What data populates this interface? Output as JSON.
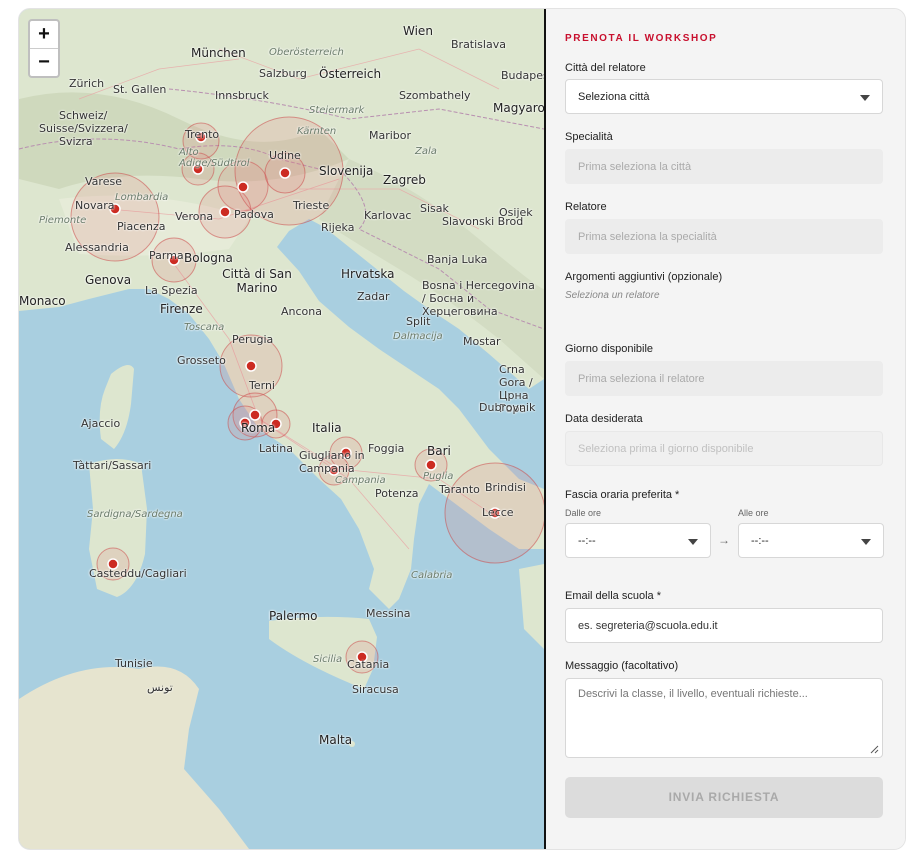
{
  "map": {
    "zoom_in_label": "+",
    "zoom_out_label": "−",
    "cities": [
      "Zürich",
      "München",
      "Salzburg",
      "Österreich",
      "Wien",
      "Bratislava",
      "Budapest",
      "St. Gallen",
      "Schweiz/",
      "Suisse/Svizzera/",
      "Svizra",
      "Innsbruck",
      "Kärnten",
      "Udine",
      "Slovenija",
      "Zagreb",
      "Maribor",
      "Szombathely",
      "Magyarország",
      "Varese",
      "Novara",
      "Lombardia",
      "Piemonte",
      "Verona",
      "Padova",
      "Trieste",
      "Rijeka",
      "Karlovac",
      "Sisak",
      "Slavonski Brod",
      "Osijek",
      "Alessandria",
      "Piacenza",
      "Parma",
      "Bologna",
      "Genova",
      "Città di San Marino",
      "Hrvatska",
      "Banja Luka",
      "Bosna i Hercegovina / Босна и Херцеговина",
      "Monaco",
      "La Spezia",
      "Firenze",
      "Toscana",
      "Ancona",
      "Zadar",
      "Split",
      "Mostar",
      "Perugia",
      "Grosseto",
      "Terni",
      "Crna Gora / Црна Гора",
      "Ajaccio",
      "Roma",
      "Latina",
      "Italia",
      "Bari",
      "Foggia",
      "Taranto",
      "Brindisi",
      "Lecce",
      "Puglia",
      "Giugliano in Campania",
      "Campania",
      "Potenza",
      "Tàttari/Sassari",
      "Sardigna/Sardegna",
      "Casteddu/Cagliari",
      "Calabria",
      "Palermo",
      "Messina",
      "Sicilia",
      "Catania",
      "Siracusa",
      "Malta",
      "Trento",
      "Alto Adige/Südtirol",
      "Dalmacija",
      "Dubrovnik",
      "Oberösterreich",
      "Steiermark",
      "Zala",
      "Tunisie",
      "تونس"
    ],
    "marker_color": "#cc2b22",
    "radius_color": "#e88080"
  },
  "form": {
    "heading": "PRENOTA IL WORKSHOP",
    "city_label": "Città del relatore",
    "city_value": "Seleziona città",
    "specialty_label": "Specialità",
    "specialty_placeholder": "Prima seleziona la città",
    "speaker_label": "Relatore",
    "speaker_placeholder": "Prima seleziona la specialità",
    "topics_label": "Argomenti aggiuntivi (opzionale)",
    "topics_hint": "Seleziona un relatore",
    "day_label": "Giorno disponibile",
    "day_placeholder": "Prima seleziona il relatore",
    "date_label": "Data desiderata",
    "date_placeholder": "Seleziona prima il giorno disponibile",
    "time_label": "Fascia oraria preferita *",
    "from_label": "Dalle ore",
    "to_label": "Alle ore",
    "from_value": "--:--",
    "to_value": "--:--",
    "time_arrow": "→",
    "email_label": "Email della scuola *",
    "email_placeholder": "es. segreteria@scuola.edu.it",
    "message_label": "Messaggio (facoltativo)",
    "message_placeholder": "Descrivi la classe, il livello, eventuali richieste...",
    "submit_label": "INVIA RICHIESTA",
    "accent_color": "#c8102e"
  }
}
